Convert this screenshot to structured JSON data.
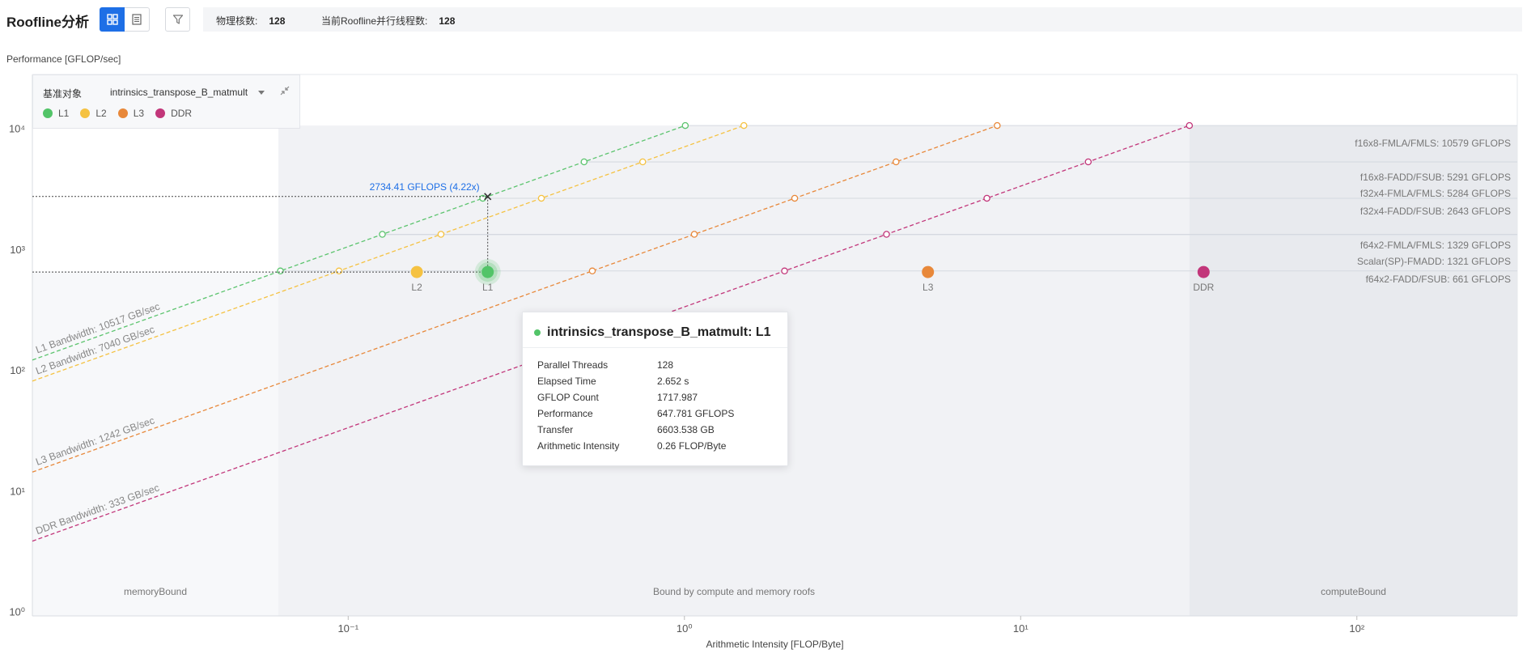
{
  "header": {
    "title": "Roofline分析",
    "info": [
      {
        "label": "物理核数:",
        "value": "128"
      },
      {
        "label": "当前Roofline并行线程数:",
        "value": "128"
      }
    ]
  },
  "legend_panel": {
    "baseline_label": "基准对象",
    "baseline_value": "intrinsics_transpose_B_matmult",
    "items": [
      {
        "name": "L1",
        "color": "#52c468"
      },
      {
        "name": "L2",
        "color": "#f5c242"
      },
      {
        "name": "L3",
        "color": "#e8883a"
      },
      {
        "name": "DDR",
        "color": "#c2367a"
      }
    ]
  },
  "tooltip": {
    "title": "intrinsics_transpose_B_matmult: L1",
    "rows": [
      {
        "k": "Parallel Threads",
        "v": "128"
      },
      {
        "k": "Elapsed Time",
        "v": "2.652 s"
      },
      {
        "k": "GFLOP Count",
        "v": "1717.987"
      },
      {
        "k": "Performance",
        "v": "647.781 GFLOPS"
      },
      {
        "k": "Transfer",
        "v": "6603.538 GB"
      },
      {
        "k": "Arithmetic Intensity",
        "v": "0.26 FLOP/Byte"
      }
    ]
  },
  "chart_data": {
    "type": "scatter",
    "ylabel": "Performance [GFLOP/sec]",
    "xlabel": "Arithmetic Intensity [FLOP/Byte]",
    "xscale": "log",
    "yscale": "log",
    "xlim": [
      0.0115,
      300
    ],
    "ylim": [
      0.92,
      28000
    ],
    "x_ticks": [
      {
        "value": 0.1,
        "label": "10⁻¹"
      },
      {
        "value": 1,
        "label": "10⁰"
      },
      {
        "value": 10,
        "label": "10¹"
      },
      {
        "value": 100,
        "label": "10²"
      }
    ],
    "y_ticks": [
      {
        "value": 1,
        "label": "10⁰"
      },
      {
        "value": 10,
        "label": "10¹"
      },
      {
        "value": 100,
        "label": "10²"
      },
      {
        "value": 1000,
        "label": "10³"
      },
      {
        "value": 10000,
        "label": "10⁴"
      }
    ],
    "compute_roofs": [
      {
        "label": "f16x8-FMLA/FMLS: 10579 GFLOPS",
        "value": 10579
      },
      {
        "label": "f16x8-FADD/FSUB: 5291 GFLOPS",
        "value": 5291
      },
      {
        "label": "f32x4-FMLA/FMLS: 5284 GFLOPS",
        "value": 5284
      },
      {
        "label": "f32x4-FADD/FSUB: 2643 GFLOPS",
        "value": 2643
      },
      {
        "label": "f64x2-FMLA/FMLS: 1329 GFLOPS",
        "value": 1329
      },
      {
        "label": "Scalar(SP)-FMADD: 1321 GFLOPS",
        "value": 1321
      },
      {
        "label": "f64x2-FADD/FSUB: 661 GFLOPS",
        "value": 661
      }
    ],
    "bandwidth_roofs": [
      {
        "name": "L1",
        "label": "L1 Bandwidth: 10517 GB/sec",
        "bandwidth": 10517,
        "color": "#5cc46e"
      },
      {
        "name": "L2",
        "label": "L2 Bandwidth: 7040 GB/sec",
        "bandwidth": 7040,
        "color": "#f5c242"
      },
      {
        "name": "L3",
        "label": "L3 Bandwidth: 1242 GB/sec",
        "bandwidth": 1242,
        "color": "#e8883a"
      },
      {
        "name": "DDR",
        "label": "DDR Bandwidth: 333 GB/sec",
        "bandwidth": 333,
        "color": "#c2367a"
      }
    ],
    "points": [
      {
        "name": "L2",
        "x": 0.16,
        "y": 647.781,
        "color": "#f5c242"
      },
      {
        "name": "L1",
        "x": 0.26,
        "y": 647.781,
        "color": "#52c468"
      },
      {
        "name": "L3",
        "x": 5.3,
        "y": 647.781,
        "color": "#e8883a"
      },
      {
        "name": "DDR",
        "x": 35,
        "y": 647.781,
        "color": "#c2367a"
      }
    ],
    "annotation": {
      "text": "2734.41 GFLOPS (4.22x)",
      "x": 0.26,
      "y": 2734.41
    },
    "regions": [
      {
        "label": "memoryBound",
        "x_from": 0.0115,
        "x_to": 0.062
      },
      {
        "label": "Bound by compute and memory roofs",
        "x_from": 0.062,
        "x_to": 31.8
      },
      {
        "label": "computeBound",
        "x_from": 31.8,
        "x_to": 300
      }
    ]
  }
}
